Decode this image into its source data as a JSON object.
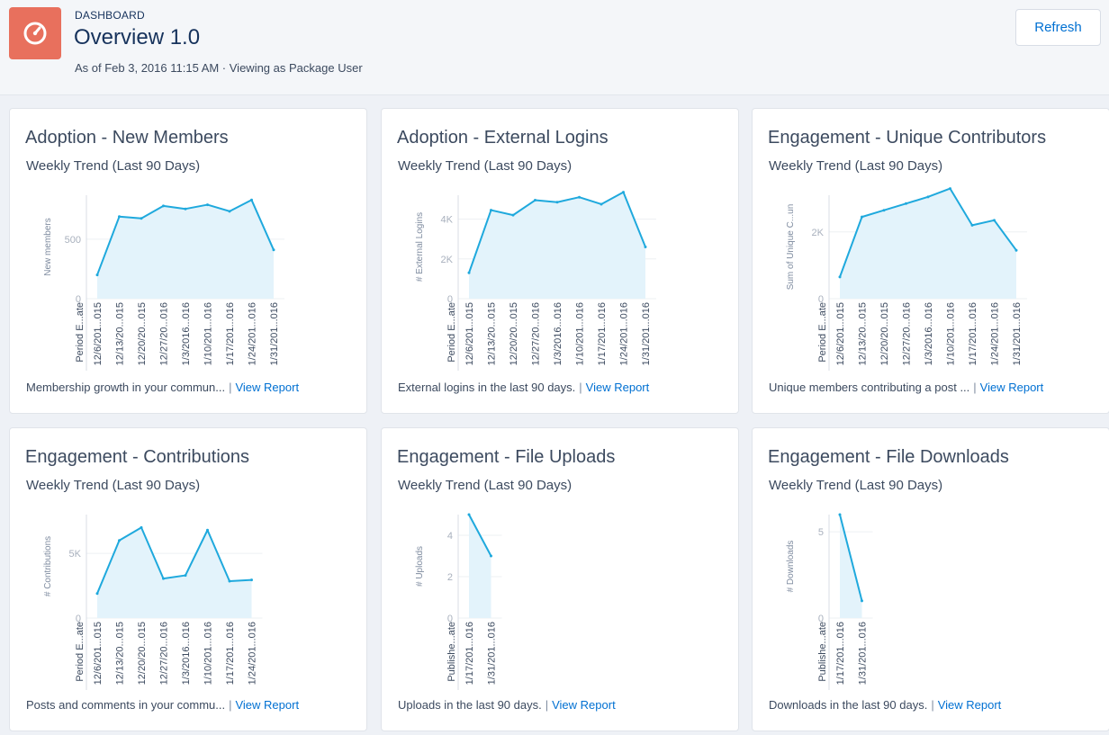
{
  "header": {
    "overline": "DASHBOARD",
    "title": "Overview 1.0",
    "subtitle": "As of Feb 3, 2016 11:15 AM · Viewing as Package User",
    "refresh_label": "Refresh",
    "icon": "gauge-icon"
  },
  "colors": {
    "accent": "#1fa9dd",
    "area": "#e3f3fb",
    "link": "#0070d2",
    "logo_bg": "#e8705d"
  },
  "cards": [
    {
      "title": "Adoption - New Members",
      "subtitle": "Weekly Trend (Last 90 Days)",
      "footer": "Membership growth in your commun...",
      "link": "View Report"
    },
    {
      "title": "Adoption - External Logins",
      "subtitle": "Weekly Trend (Last 90 Days)",
      "footer": "External logins in the last 90 days.",
      "link": "View Report"
    },
    {
      "title": "Engagement - Unique Contributors",
      "subtitle": "Weekly Trend (Last 90 Days)",
      "footer": "Unique members contributing a post ...",
      "link": "View Report"
    },
    {
      "title": "Engagement - Contributions",
      "subtitle": "Weekly Trend (Last 90 Days)",
      "footer": "Posts and comments in your commu...",
      "link": "View Report"
    },
    {
      "title": "Engagement - File Uploads",
      "subtitle": "Weekly Trend (Last 90 Days)",
      "footer": "Uploads in the last 90 days.",
      "link": "View Report"
    },
    {
      "title": "Engagement - File Downloads",
      "subtitle": "Weekly Trend (Last 90 Days)",
      "footer": "Downloads in the last 90 days.",
      "link": "View Report"
    }
  ],
  "chart_data": [
    {
      "type": "area",
      "ylabel": "New members",
      "xlabel": "Period E...ate",
      "ylim": [
        0,
        870
      ],
      "yticks": [
        0,
        500
      ],
      "ytick_labels": [
        "0",
        "500"
      ],
      "categories": [
        "12/6/201...015",
        "12/13/20...015",
        "12/20/20...015",
        "12/27/20...016",
        "1/3/2016...016",
        "1/10/201...016",
        "1/17/201...016",
        "1/24/201...016",
        "1/31/201...016"
      ],
      "values": [
        200,
        690,
        675,
        780,
        755,
        790,
        735,
        830,
        410
      ]
    },
    {
      "type": "area",
      "ylabel": "# External Logins",
      "xlabel": "Period E...ate",
      "ylim": [
        0,
        5200
      ],
      "yticks": [
        0,
        2000,
        4000
      ],
      "ytick_labels": [
        "0",
        "2K",
        "4K"
      ],
      "categories": [
        "12/6/201...015",
        "12/13/20...015",
        "12/20/20...015",
        "12/27/20...016",
        "1/3/2016...016",
        "1/10/201...016",
        "1/17/201...016",
        "1/24/201...016",
        "1/31/201...016"
      ],
      "values": [
        1300,
        4450,
        4200,
        4950,
        4850,
        5100,
        4750,
        5350,
        2600
      ]
    },
    {
      "type": "area",
      "ylabel": "Sum of Unique C...un",
      "xlabel": "Period E...ate",
      "ylim": [
        0,
        3100
      ],
      "yticks": [
        0,
        2000
      ],
      "ytick_labels": [
        "0",
        "2K"
      ],
      "categories": [
        "12/6/201...015",
        "12/13/20...015",
        "12/20/20...015",
        "12/27/20...016",
        "1/3/2016...016",
        "1/10/201...016",
        "1/17/201...016",
        "1/24/201...016",
        "1/31/201...016"
      ],
      "values": [
        650,
        2450,
        2650,
        2850,
        3050,
        3300,
        2200,
        2350,
        1450
      ]
    },
    {
      "type": "area",
      "ylabel": "# Contributions",
      "xlabel": "Period E...ate",
      "ylim": [
        0,
        8000
      ],
      "yticks": [
        0,
        5000
      ],
      "ytick_labels": [
        "0",
        "5K"
      ],
      "categories": [
        "12/6/201...015",
        "12/13/20...015",
        "12/20/20...015",
        "12/27/20...016",
        "1/3/2016...016",
        "1/10/201...016",
        "1/17/201...016",
        "1/24/201...016"
      ],
      "values": [
        1900,
        6000,
        7000,
        3050,
        3300,
        6800,
        2850,
        2950
      ]
    },
    {
      "type": "area",
      "ylabel": "# Uploads",
      "xlabel": "Publishe...ate",
      "ylim": [
        0,
        5
      ],
      "yticks": [
        0,
        2,
        4
      ],
      "ytick_labels": [
        "0",
        "2",
        "4"
      ],
      "categories": [
        "1/17/201...016",
        "1/31/201...016"
      ],
      "values": [
        5,
        3
      ]
    },
    {
      "type": "area",
      "ylabel": "# Downloads",
      "xlabel": "Publishe...ate",
      "ylim": [
        0,
        6
      ],
      "yticks": [
        0,
        5
      ],
      "ytick_labels": [
        "0",
        "5"
      ],
      "categories": [
        "1/17/201...016",
        "1/31/201...016"
      ],
      "values": [
        6,
        1
      ]
    }
  ]
}
